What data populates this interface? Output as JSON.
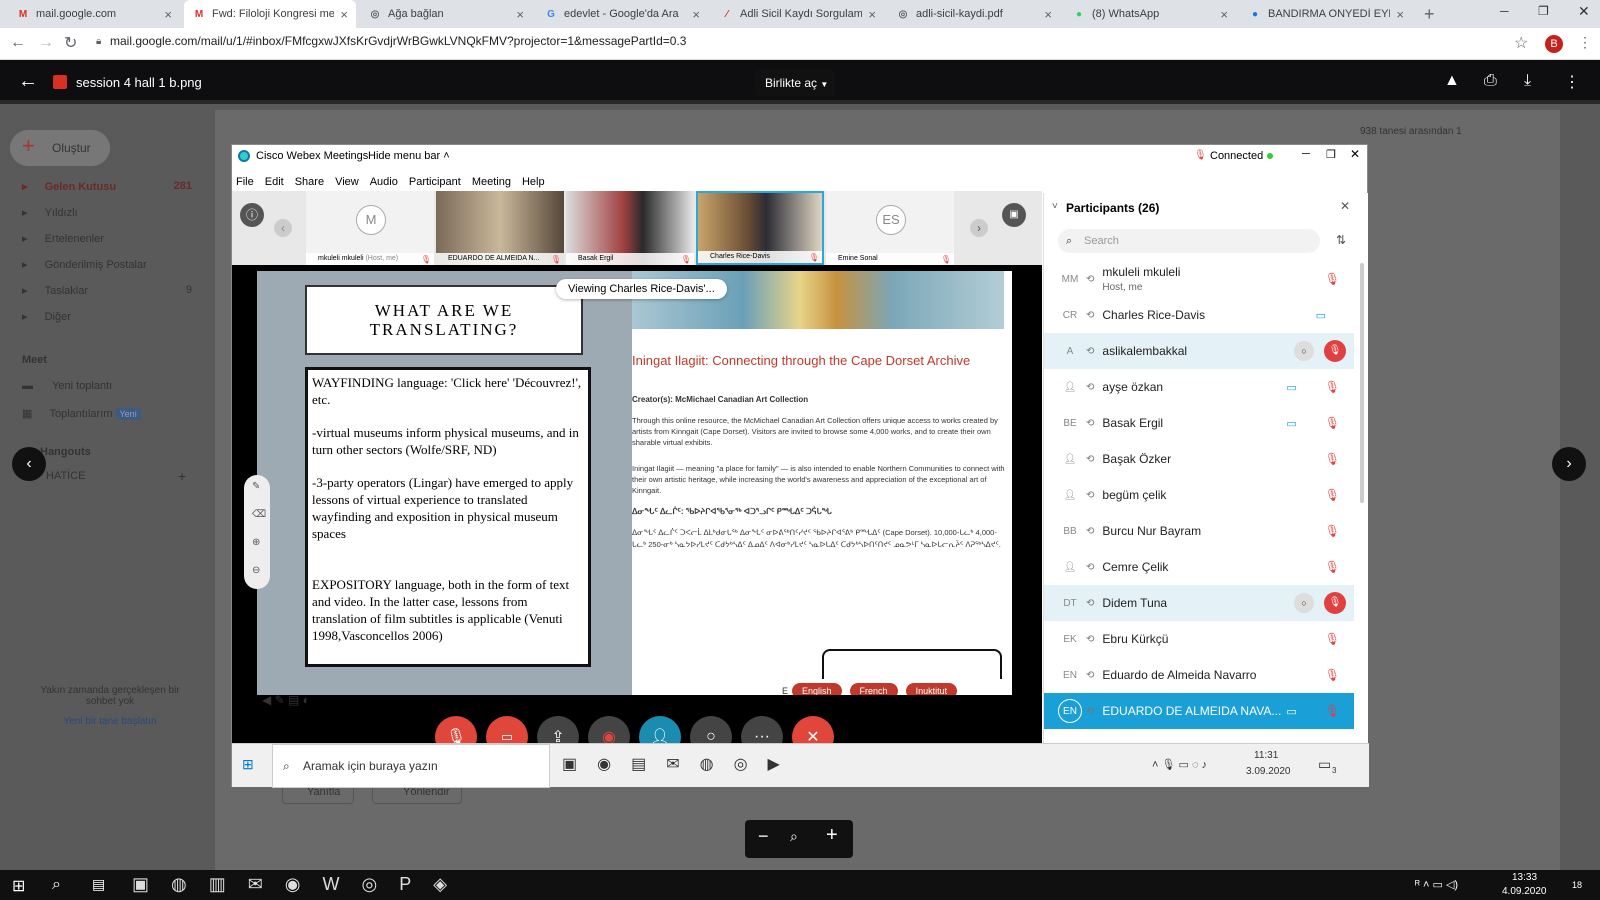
{
  "browser": {
    "tabs": [
      {
        "title": "mail.google.com",
        "fav": "M",
        "favColor": "#d93025"
      },
      {
        "title": "Fwd: Filoloji Kongresi metin",
        "fav": "M",
        "favColor": "#d93025"
      },
      {
        "title": "Ağa bağlan",
        "fav": "◎",
        "favColor": "#5f6368"
      },
      {
        "title": "edevlet - Google'da Ara",
        "fav": "G",
        "favColor": "#4285f4"
      },
      {
        "title": "Adli Sicil Kaydı Sorgulama",
        "fav": "⁄",
        "favColor": "#d93025"
      },
      {
        "title": "adli-sicil-kaydi.pdf",
        "fav": "◎",
        "favColor": "#5f6368"
      },
      {
        "title": "(8) WhatsApp",
        "fav": "●",
        "favColor": "#25d366"
      },
      {
        "title": "BANDIRMA ONYEDİ EYLÜL",
        "fav": "●",
        "favColor": "#1a73e8"
      }
    ],
    "url": "mail.google.com/mail/u/1/#inbox/FMfcgxwJXfsKrGvdjrWrBGwkLVNQkFMV?projector=1&messagePartId=0.3",
    "profile": "B"
  },
  "viewer": {
    "filename": "session 4 hall 1 b.png",
    "open_with": "Birlikte aç",
    "zoom_minus": "−",
    "zoom_plus": "+"
  },
  "gmail": {
    "compose": "Oluştur",
    "items": [
      {
        "label": "Gelen Kutusu",
        "count": "281"
      },
      {
        "label": "Yıldızlı",
        "count": ""
      },
      {
        "label": "Ertelenenler",
        "count": ""
      },
      {
        "label": "Gönderilmiş Postalar",
        "count": ""
      },
      {
        "label": "Taslaklar",
        "count": "9"
      },
      {
        "label": "Diğer",
        "count": ""
      }
    ],
    "meet_heading": "Meet",
    "meet_items": [
      "Yeni toplantı",
      "Toplantılarım"
    ],
    "new_badge": "Yeni",
    "hangouts": "Hangouts",
    "hangouts_user": "HATİCE",
    "footer1": "Yakın zamanda gerçekleşen bir sohbet yok",
    "footer2": "Yeni bir tane başlatın",
    "reply": "Yanıtla",
    "forward": "Yönlendir",
    "count_text": "938 tanesi arasından 1"
  },
  "webex": {
    "title": "Cisco Webex Meetings",
    "hide_menu": "Hide menu bar",
    "status": "Connected",
    "menu": [
      "File",
      "Edit",
      "Share",
      "View",
      "Audio",
      "Participant",
      "Meeting",
      "Help"
    ],
    "thumbs": [
      {
        "name": "mkuleli mkuleli",
        "role": "(Host, me)",
        "initial": "M"
      },
      {
        "name": "EDUARDO DE ALMEIDA N...",
        "role": "",
        "initial": ""
      },
      {
        "name": "Basak Ergil",
        "role": "",
        "initial": ""
      },
      {
        "name": "Charles Rice-Davis",
        "role": "",
        "initial": ""
      },
      {
        "name": "Emine Sonal",
        "role": "",
        "initial": "ES"
      }
    ],
    "viewing": "Viewing Charles Rice-Davis'...",
    "slide": {
      "title": "WHAT ARE WE TRANSLATING?",
      "p1": "WAYFINDING language: 'Click here' 'Découvrez!', etc.",
      "p2": "-virtual museums inform physical museums, and in turn other sectors  (Wolfe/SRF, ND)",
      "p3": "-3-party operators (Lingar) have emerged to apply lessons of virtual experience to translated wayfinding and exposition in physical museum spaces",
      "p4": "EXPOSITORY language, both in the form of text and video. In the latter case, lessons from translation of film subtitles is applicable (Venuti 1998,Vasconcellos 2006)",
      "web_title": "Iningat Ilagiit: Connecting through the Cape Dorset Archive",
      "creator": "Creator(s): McMichael Canadian Art Collection",
      "web_p1": "Through this online resource, the McMichael Canadian Art Collection offers unique access to works created by artists from Kinngait (Cape Dorset). Visitors are invited to browse some 4,000 works, and to create their own sharable virtual exhibits.",
      "web_p2": "Iningat Ilagiit — meaning \"a place for family\" — is also intended to enable Northern Communities to connect with their own artistic heritage, while increasing the world's awareness and appreciation of the exceptional art of Kinngait.",
      "syll1": "ᐃᓂᖓᑦ ᐃᓚᒌᑦ: ᖃᐅᔨᒋᐊᖃᕐᓂᖅ ᐊᑐᕐᓗᒋᑦ ᑭᙵᐃᑦ ᑐᕌᒐᖓ",
      "syll2": "ᐃᓂᖓᑦ ᐃᓚᒌᑦ ᑐᐸᓕᒫ ᐃᒪᒃᑯᓂᒐᖅ ᐃᓂᖓᑦ ᓂᐅᕕᖅᑎᑦᓯᔪᑦ ᖃᐅᔨᒋᐊᕐᕕᒃ ᑭᙵᐃᑦ (Cape Dorset). 10,000-ᒐᓚᒃ 4,000-ᒐᓚᒃ 250-ᓂᒃ ᓴᓇᔭᐅᓯᒪᔪᑦ ᑕᑯᔭᒃᓴᐃᑦ ᐃᓄᐃᑦ ᐱᐊᓂᒃᓯᒪᔪᑦ ᓴᓇᐅᒐᐃᑦ ᑕᑯᔭᒃᓴᐅᑎᑦᑎᔪᑦ ᓄᓇᕗᒻᒥ ᓴᓇᐅᒐᓕᕆᔩᑦ ᐱᕈᖅᓴᐃᔪᑦ.",
      "lang_prefix": "E",
      "langs": [
        "English",
        "French",
        "Inuktitut"
      ]
    },
    "participants_title": "Participants (26)",
    "search_placeholder": "Search",
    "participants": [
      {
        "initials": "MM",
        "name": "mkuleli mkuleli",
        "sub": "Host, me",
        "cam": false,
        "mic": "muted",
        "hl": false
      },
      {
        "initials": "CR",
        "name": "Charles Rice-Davis",
        "sub": "",
        "cam": true,
        "mic": "none",
        "hl": false
      },
      {
        "initials": "A",
        "name": "aslikalembakkal",
        "sub": "",
        "cam": false,
        "mic": "active",
        "hl": true
      },
      {
        "initials": "",
        "name": "ayşe özkan",
        "sub": "",
        "cam": true,
        "mic": "muted",
        "hl": false
      },
      {
        "initials": "BE",
        "name": "Basak Ergil",
        "sub": "",
        "cam": true,
        "mic": "muted",
        "hl": false
      },
      {
        "initials": "",
        "name": "Başak Özker",
        "sub": "",
        "cam": false,
        "mic": "muted",
        "hl": false
      },
      {
        "initials": "",
        "name": "begüm çelik",
        "sub": "",
        "cam": false,
        "mic": "muted",
        "hl": false
      },
      {
        "initials": "BB",
        "name": "Burcu Nur Bayram",
        "sub": "",
        "cam": false,
        "mic": "muted",
        "hl": false
      },
      {
        "initials": "",
        "name": "Cemre Çelik",
        "sub": "",
        "cam": false,
        "mic": "muted",
        "hl": false
      },
      {
        "initials": "DT",
        "name": "Didem Tuna",
        "sub": "",
        "cam": false,
        "mic": "active",
        "hl": true
      },
      {
        "initials": "EK",
        "name": "Ebru Kürkçü",
        "sub": "",
        "cam": false,
        "mic": "muted",
        "hl": false
      },
      {
        "initials": "EN",
        "name": "Eduardo de Almeida Navarro",
        "sub": "",
        "cam": false,
        "mic": "muted",
        "hl": false
      },
      {
        "initials": "EN",
        "name": "EDUARDO DE ALMEIDA NAVA...",
        "sub": "",
        "cam": true,
        "mic": "muted",
        "hl": "selected"
      }
    ],
    "inner_taskbar": {
      "search": "Aramak için buraya yazın",
      "time": "11:31",
      "date": "3.09.2020",
      "notif": "3"
    }
  },
  "taskbar": {
    "time": "13:33",
    "date": "4.09.2020",
    "notif": "18"
  }
}
